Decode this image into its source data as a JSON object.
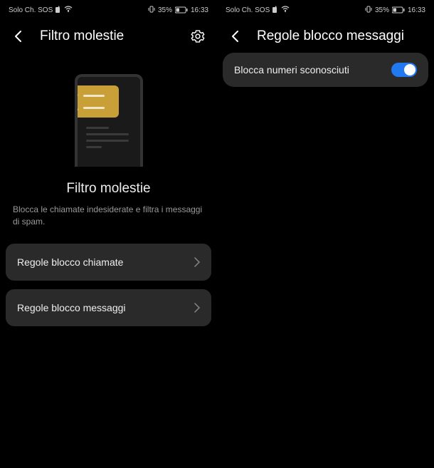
{
  "status": {
    "carrier": "Solo Ch. SOS",
    "battery_percent": "35%",
    "time": "16:33"
  },
  "left": {
    "title": "Filtro molestie",
    "section_title": "Filtro molestie",
    "description": "Blocca le chiamate indesiderate e filtra i messaggi di spam.",
    "option1": "Regole blocco chiamate",
    "option2": "Regole blocco messaggi"
  },
  "right": {
    "title": "Regole blocco messaggi",
    "toggle_label": "Blocca numeri sconosciuti",
    "toggle_on": true
  }
}
